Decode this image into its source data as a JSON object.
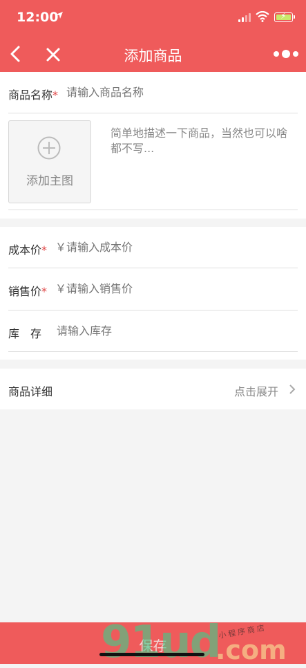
{
  "status_bar": {
    "time": "12:00"
  },
  "nav": {
    "title": "添加商品"
  },
  "product_name": {
    "label": "商品名称",
    "required_mark": "*",
    "placeholder": "请输入商品名称"
  },
  "main_image": {
    "label": "添加主图"
  },
  "description": {
    "placeholder": "简单地描述一下商品，当然也可以啥都不写..."
  },
  "cost_price": {
    "label": "成本价",
    "required_mark": "*",
    "placeholder": "￥请输入成本价"
  },
  "sale_price": {
    "label": "销售价",
    "required_mark": "*",
    "placeholder": "￥请输入销售价"
  },
  "stock": {
    "label": "库　存",
    "placeholder": "请输入库存"
  },
  "detail": {
    "label": "商品详细",
    "expand_label": "点击展开"
  },
  "bottom": {
    "save_label": "保存"
  },
  "watermark": {
    "number": "91ud",
    "domain": ".com",
    "caption": "小程序商店"
  },
  "colors": {
    "brand": "#ef5b5b",
    "required": "#e04848",
    "background": "#f4f4f4"
  },
  "icons": [
    "location-arrow-icon",
    "signal-icon",
    "wifi-icon",
    "battery-icon",
    "back-icon",
    "close-icon",
    "more-icon",
    "add-image-icon",
    "chevron-right-icon"
  ]
}
